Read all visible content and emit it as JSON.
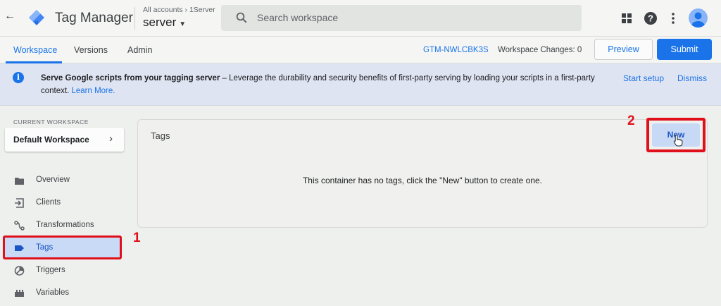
{
  "app": {
    "title": "Tag Manager",
    "breadcrumb": "All accounts › 1Server",
    "container_name": "server",
    "search_placeholder": "Search workspace"
  },
  "subnav": {
    "tabs": [
      "Workspace",
      "Versions",
      "Admin"
    ],
    "active_tab": "Workspace",
    "container_id": "GTM-NWLCBK3S",
    "workspace_changes": "Workspace Changes: 0",
    "preview_label": "Preview",
    "submit_label": "Submit"
  },
  "banner": {
    "title": "Serve Google scripts from your tagging server",
    "body": " – Leverage the durability and security benefits of first-party serving by loading your scripts in a first-party context. ",
    "learn_more": "Learn More.",
    "start_setup": "Start setup",
    "dismiss": "Dismiss"
  },
  "sidebar": {
    "current_workspace_label": "CURRENT WORKSPACE",
    "workspace_name": "Default Workspace",
    "items": [
      {
        "label": "Overview",
        "icon": "overview-icon"
      },
      {
        "label": "Clients",
        "icon": "clients-icon"
      },
      {
        "label": "Transformations",
        "icon": "transformations-icon"
      },
      {
        "label": "Tags",
        "icon": "tag-icon",
        "active": true
      },
      {
        "label": "Triggers",
        "icon": "triggers-icon"
      },
      {
        "label": "Variables",
        "icon": "variables-icon"
      }
    ]
  },
  "main": {
    "panel_title": "Tags",
    "new_button": "New",
    "empty_message": "This container has no tags, click the \"New\" button to create one."
  },
  "annotations": {
    "step1": "1",
    "step2": "2",
    "highlight_color": "#e0101a"
  },
  "colors": {
    "accent": "#1a73e8",
    "active_nav_bg": "#c9daf7",
    "banner_bg": "#dfe4f2"
  }
}
